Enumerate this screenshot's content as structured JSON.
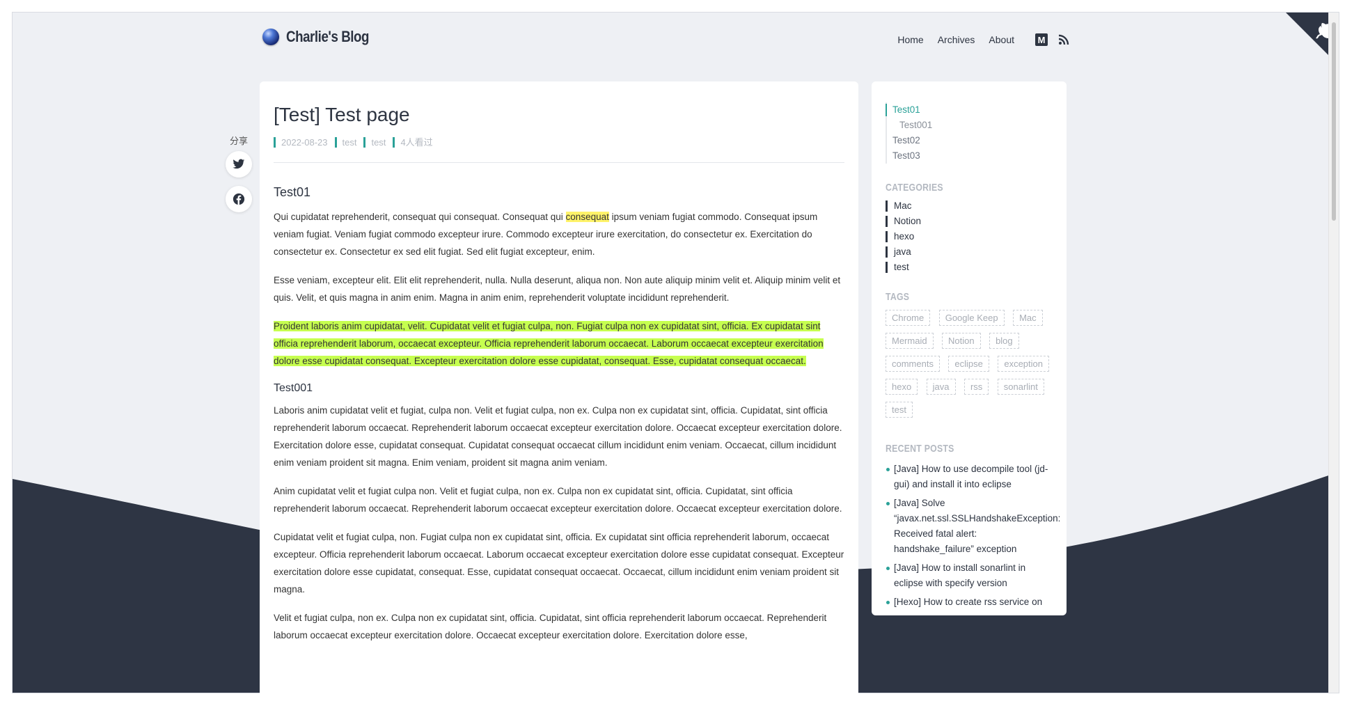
{
  "brand": {
    "name": "Charlie's Blog"
  },
  "nav": {
    "items": [
      "Home",
      "Archives",
      "About"
    ],
    "medium_icon": "medium-icon",
    "rss_icon": "rss-icon"
  },
  "share": {
    "label": "分享",
    "buttons": [
      "twitter-icon",
      "facebook-icon"
    ]
  },
  "post": {
    "title": "[Test] Test page",
    "meta": {
      "date": "2022-08-23",
      "category": "test",
      "tag": "test",
      "views": "4人看过"
    },
    "sections": {
      "h1": "Test01",
      "p1_a": "Qui cupidatat reprehenderit, consequat qui consequat. Consequat qui ",
      "p1_hl": "consequat",
      "p1_b": " ipsum veniam fugiat commodo. Consequat ipsum veniam fugiat. Veniam fugiat commodo excepteur irure. Commodo excepteur irure exercitation, do consectetur ex. Exercitation do consectetur ex. Consectetur ex sed elit fugiat. Sed elit fugiat excepteur, enim.",
      "p2": "Esse veniam, excepteur elit. Elit elit reprehenderit, nulla. Nulla deserunt, aliqua non. Non aute aliquip minim velit et. Aliquip minim velit et quis. Velit, et quis magna in anim enim. Magna in anim enim, reprehenderit voluptate incididunt reprehenderit.",
      "p3": "Proident laboris anim cupidatat, velit. Cupidatat velit et fugiat culpa, non. Fugiat culpa non ex cupidatat sint, officia. Ex cupidatat sint officia reprehenderit laborum, occaecat excepteur. Officia reprehenderit laborum occaecat. Laborum occaecat excepteur exercitation dolore esse cupidatat consequat. Excepteur exercitation dolore esse cupidatat, consequat. Esse, cupidatat consequat occaecat.",
      "h2": "Test001",
      "p4": "Laboris anim cupidatat velit et fugiat, culpa non. Velit et fugiat culpa, non ex. Culpa non ex cupidatat sint, officia. Cupidatat, sint officia reprehenderit laborum occaecat. Reprehenderit laborum occaecat excepteur exercitation dolore. Occaecat excepteur exercitation dolore. Exercitation dolore esse, cupidatat consequat. Cupidatat consequat occaecat cillum incididunt enim veniam. Occaecat, cillum incididunt enim veniam proident sit magna. Enim veniam, proident sit magna anim veniam.",
      "p5": "Anim cupidatat velit et fugiat culpa non. Velit et fugiat culpa, non ex. Culpa non ex cupidatat sint, officia. Cupidatat, sint officia reprehenderit laborum occaecat. Reprehenderit laborum occaecat excepteur exercitation dolore. Occaecat excepteur exercitation dolore.",
      "p6": "Cupidatat velit et fugiat culpa, non. Fugiat culpa non ex cupidatat sint, officia. Ex cupidatat sint officia reprehenderit laborum, occaecat excepteur. Officia reprehenderit laborum occaecat. Laborum occaecat excepteur exercitation dolore esse cupidatat consequat. Excepteur exercitation dolore esse cupidatat, consequat. Esse, cupidatat consequat occaecat. Occaecat, cillum incididunt enim veniam proident sit magna.",
      "p7": "Velit et fugiat culpa, non ex. Culpa non ex cupidatat sint, officia. Cupidatat, sint officia reprehenderit laborum occaecat. Reprehenderit laborum occaecat excepteur exercitation dolore. Occaecat excepteur exercitation dolore. Exercitation dolore esse,"
    }
  },
  "sidebar": {
    "toc": [
      "Test01",
      "Test001",
      "Test02",
      "Test03"
    ],
    "categories_title": "CATEGORIES",
    "categories": [
      "Mac",
      "Notion",
      "hexo",
      "java",
      "test"
    ],
    "tags_title": "TAGS",
    "tags": [
      "Chrome",
      "Google Keep",
      "Mac",
      "Mermaid",
      "Notion",
      "blog",
      "comments",
      "eclipse",
      "exception",
      "hexo",
      "java",
      "rss",
      "sonarlint",
      "test"
    ],
    "recent_title": "RECENT POSTS",
    "recent": [
      "[Java] How to use decompile tool (jd-gui) and install it into eclipse",
      "[Java] Solve “javax.net.ssl.SSLHandshakeException: Received fatal alert: handshake_failure” exception",
      "[Java] How to install sonarlint in eclipse with specify version",
      "[Hexo] How to create rss service on"
    ]
  },
  "colors": {
    "accent": "#2aa198",
    "dark": "#2d3441",
    "background": "#eef0f4",
    "wave": "#2e3544"
  }
}
